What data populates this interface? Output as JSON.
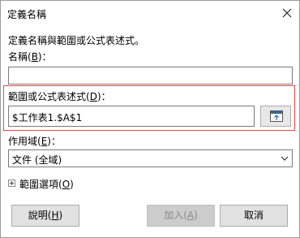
{
  "window": {
    "title": "定義名稱"
  },
  "description": "定義名稱與範圍或公式表述式。",
  "name_field": {
    "label": "名稱(",
    "mnemonic": "B",
    "label_end": ")：",
    "value": ""
  },
  "ref_field": {
    "label": "範圍或公式表述式(",
    "mnemonic": "D",
    "label_end": ")：",
    "value": "$工作表1.$A$1"
  },
  "scope_field": {
    "label": "作用域(",
    "mnemonic": "E",
    "label_end": ")：",
    "selected": "文件 (全域)"
  },
  "options": {
    "label": "範圍選項(",
    "mnemonic": "O",
    "label_end": ")"
  },
  "buttons": {
    "help": {
      "label": "說明(",
      "mnemonic": "H",
      "label_end": ")"
    },
    "add": {
      "label": "加入(",
      "mnemonic": "A",
      "label_end": ")"
    },
    "cancel": "取消"
  }
}
